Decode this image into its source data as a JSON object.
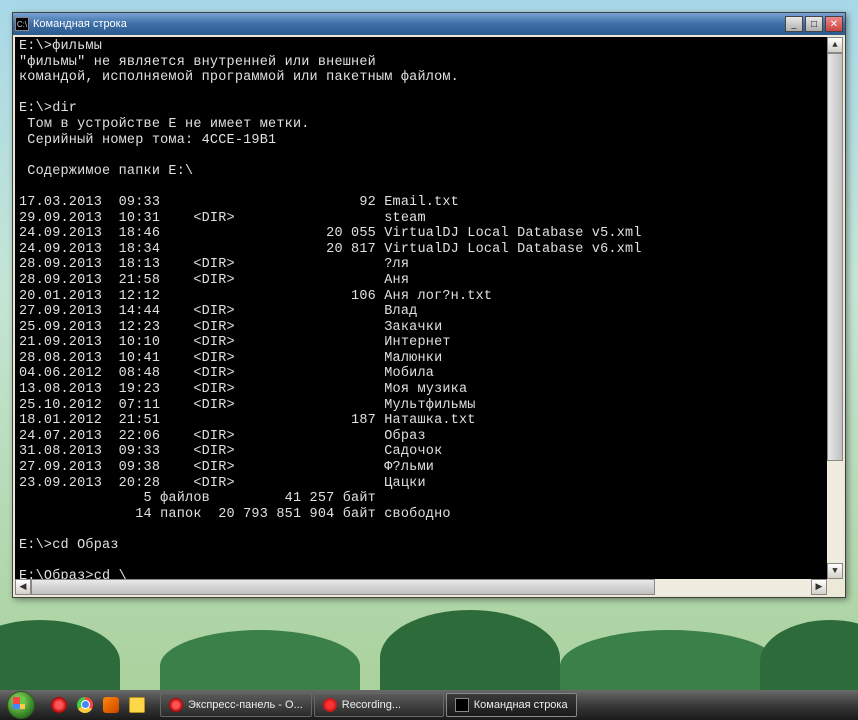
{
  "window": {
    "title": "Командная строка",
    "icon_glyph": "C:\\"
  },
  "console": {
    "prompt1": "E:\\>",
    "cmd1": "фильмы",
    "err_line1": "\"фильмы\" не является внутренней или внешней",
    "err_line2": "командой, исполняемой программой или пакетным файлом.",
    "prompt2": "E:\\>",
    "cmd2": "dir",
    "vol_line": " Том в устройстве E не имеет метки.",
    "serial_line": " Серийный номер тома: 4CCE-19B1",
    "content_line": " Содержимое папки E:\\",
    "entries": [
      {
        "date": "17.03.2013",
        "time": "09:33",
        "dir": "",
        "size": "92",
        "name": "Email.txt"
      },
      {
        "date": "29.09.2013",
        "time": "10:31",
        "dir": "<DIR>",
        "size": "",
        "name": "steam"
      },
      {
        "date": "24.09.2013",
        "time": "18:46",
        "dir": "",
        "size": "20 055",
        "name": "VirtualDJ Local Database v5.xml"
      },
      {
        "date": "24.09.2013",
        "time": "18:34",
        "dir": "",
        "size": "20 817",
        "name": "VirtualDJ Local Database v6.xml"
      },
      {
        "date": "28.09.2013",
        "time": "18:13",
        "dir": "<DIR>",
        "size": "",
        "name": "?ля"
      },
      {
        "date": "28.09.2013",
        "time": "21:58",
        "dir": "<DIR>",
        "size": "",
        "name": "Аня"
      },
      {
        "date": "20.01.2013",
        "time": "12:12",
        "dir": "",
        "size": "106",
        "name": "Аня лог?н.txt"
      },
      {
        "date": "27.09.2013",
        "time": "14:44",
        "dir": "<DIR>",
        "size": "",
        "name": "Влад"
      },
      {
        "date": "25.09.2013",
        "time": "12:23",
        "dir": "<DIR>",
        "size": "",
        "name": "Закачки"
      },
      {
        "date": "21.09.2013",
        "time": "10:10",
        "dir": "<DIR>",
        "size": "",
        "name": "Интернет"
      },
      {
        "date": "28.08.2013",
        "time": "10:41",
        "dir": "<DIR>",
        "size": "",
        "name": "Малюнки"
      },
      {
        "date": "04.06.2012",
        "time": "08:48",
        "dir": "<DIR>",
        "size": "",
        "name": "Мобила"
      },
      {
        "date": "13.08.2013",
        "time": "19:23",
        "dir": "<DIR>",
        "size": "",
        "name": "Моя музика"
      },
      {
        "date": "25.10.2012",
        "time": "07:11",
        "dir": "<DIR>",
        "size": "",
        "name": "Мультфильмы"
      },
      {
        "date": "18.01.2012",
        "time": "21:51",
        "dir": "",
        "size": "187",
        "name": "Наташка.txt"
      },
      {
        "date": "24.07.2013",
        "time": "22:06",
        "dir": "<DIR>",
        "size": "",
        "name": "Образ"
      },
      {
        "date": "31.08.2013",
        "time": "09:33",
        "dir": "<DIR>",
        "size": "",
        "name": "Садочок"
      },
      {
        "date": "27.09.2013",
        "time": "09:38",
        "dir": "<DIR>",
        "size": "",
        "name": "Ф?льми"
      },
      {
        "date": "23.09.2013",
        "time": "20:28",
        "dir": "<DIR>",
        "size": "",
        "name": "Цацки"
      }
    ],
    "summary_files": "               5 файлов         41 257 байт",
    "summary_dirs": "              14 папок  20 793 851 904 байт свободно",
    "prompt3": "E:\\>",
    "cmd3": "cd Образ",
    "prompt4": "E:\\Образ>",
    "cmd4": "cd \\"
  },
  "taskbar": {
    "items": [
      {
        "label": "Экспресс-панель - O...",
        "icon": "opera"
      },
      {
        "label": "Recording...",
        "icon": "rec"
      },
      {
        "label": "Командная строка",
        "icon": "cmd",
        "active": true
      }
    ]
  }
}
